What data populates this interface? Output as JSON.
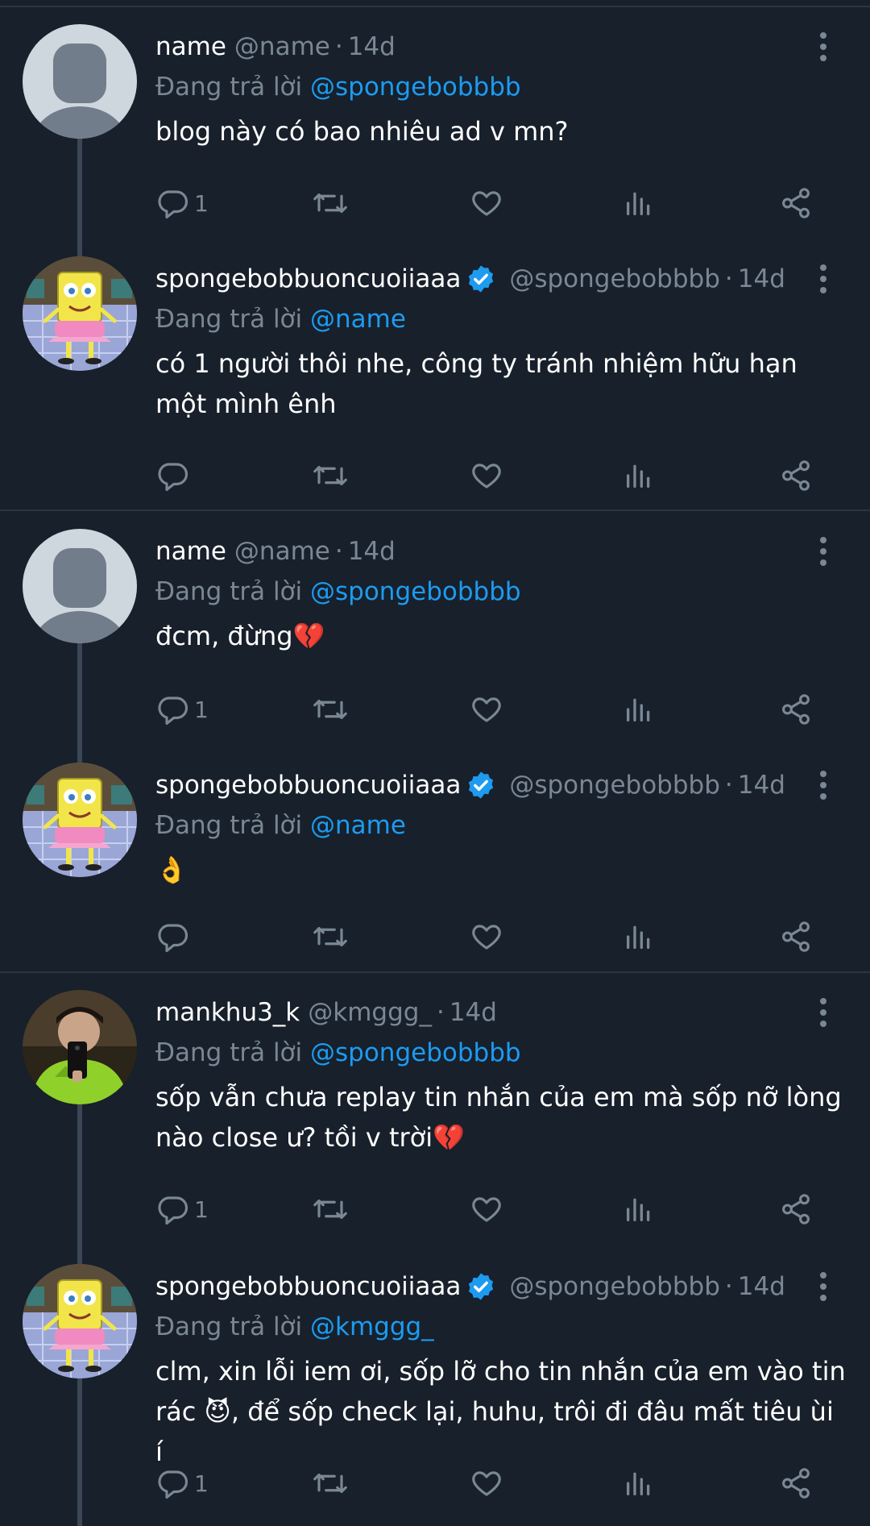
{
  "tweets": [
    {
      "name": "name",
      "handle": "@name",
      "time": "14d",
      "verified": false,
      "reply_prefix": "Đang trả lời",
      "reply_to": "@spongebobbbb",
      "text": "blog này có bao nhiêu ad v mn?",
      "reply_count": "1",
      "avatar": "default"
    },
    {
      "name": "spongebobbuoncuoiiaaa",
      "handle": "@spongebobbbb",
      "time": "14d",
      "verified": true,
      "reply_prefix": "Đang trả lời",
      "reply_to": "@name",
      "text": "có 1 người thôi nhe, công ty tránh nhiệm hữu hạn một mình ênh",
      "reply_count": "",
      "avatar": "sponge"
    },
    {
      "name": "name",
      "handle": "@name",
      "time": "14d",
      "verified": false,
      "reply_prefix": "Đang trả lời",
      "reply_to": "@spongebobbbb",
      "text": "đcm, đừng💔",
      "reply_count": "1",
      "avatar": "default"
    },
    {
      "name": "spongebobbuoncuoiiaaa",
      "handle": "@spongebobbbb",
      "time": "14d",
      "verified": true,
      "reply_prefix": "Đang trả lời",
      "reply_to": "@name",
      "text": "👌",
      "reply_count": "",
      "avatar": "sponge"
    },
    {
      "name": "mankhu3_k",
      "handle": "@kmggg_",
      "time": "14d",
      "verified": false,
      "reply_prefix": "Đang trả lời",
      "reply_to": "@spongebobbbb",
      "text": "sốp vẫn chưa replay tin nhắn của em mà sốp nỡ lòng nào close ư? tồi v trời💔",
      "reply_count": "1",
      "avatar": "photo"
    },
    {
      "name": "spongebobbuoncuoiiaaa",
      "handle": "@spongebobbbb",
      "time": "14d",
      "verified": true,
      "reply_prefix": "Đang trả lời",
      "reply_to": "@kmggg_",
      "text": "clm, xin lỗi iem ơi, sốp lỡ cho tin nhắn của em vào tin rác 😈, để sốp check lại, huhu, trôi đi đâu mất tiêu ùi í",
      "reply_count": "1",
      "avatar": "sponge"
    }
  ],
  "icons": {
    "reply": "reply-icon",
    "retweet": "retweet-icon",
    "like": "heart-icon",
    "views": "views-icon",
    "share": "share-icon",
    "more": "more-icon",
    "verified": "verified-badge-icon"
  },
  "colors": {
    "background": "#17202b",
    "muted": "#7a8794",
    "accent": "#1d9bf0",
    "divider": "#2b3643"
  }
}
